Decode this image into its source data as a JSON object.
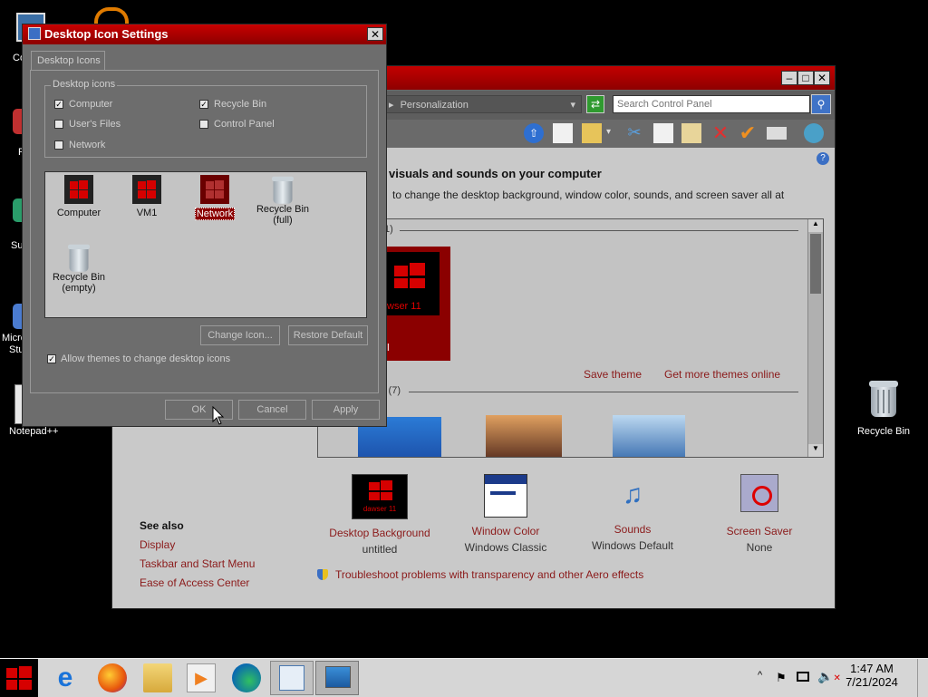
{
  "desktop": {
    "left_labels": [
      "Co",
      "F",
      "Su",
      "Micro",
      "Stu",
      "Notepad++"
    ],
    "recycle_bin": "Recycle Bin"
  },
  "control_panel": {
    "address": "Personalization",
    "search_placeholder": "Search Control Panel",
    "heading": "visuals and sounds on your computer",
    "subheading": "to change the desktop background, window color, sounds, and screen saver all at",
    "theme_group1": "1)",
    "theme_group2": "s (7)",
    "selected_theme_label": "wser 11",
    "selected_theme_sub": "ol",
    "save_theme": "Save theme",
    "get_more_themes": "Get more themes online",
    "see_also": {
      "title": "See also",
      "items": [
        "Display",
        "Taskbar and Start Menu",
        "Ease of Access Center"
      ]
    },
    "bottom": [
      {
        "name": "Desktop Background",
        "value": "untitled"
      },
      {
        "name": "Window Color",
        "value": "Windows Classic"
      },
      {
        "name": "Sounds",
        "value": "Windows Default"
      },
      {
        "name": "Screen Saver",
        "value": "None"
      }
    ],
    "db_logo_text": "dawser 11",
    "troubleshoot": "Troubleshoot problems with transparency and other Aero effects"
  },
  "dialog": {
    "title": "Desktop Icon Settings",
    "tab": "Desktop Icons",
    "group_label": "Desktop icons",
    "checks": [
      {
        "label": "Computer",
        "checked": true
      },
      {
        "label": "Recycle Bin",
        "checked": true
      },
      {
        "label": "User's Files",
        "checked": false
      },
      {
        "label": "Control Panel",
        "checked": false
      },
      {
        "label": "Network",
        "checked": false
      }
    ],
    "icons": [
      "Computer",
      "VM1",
      "Network",
      "Recycle Bin (full)",
      "Recycle Bin (empty)"
    ],
    "icon_label_lines": {
      "rb_full_1": "Recycle Bin",
      "rb_full_2": "(full)",
      "rb_empty_1": "Recycle Bin",
      "rb_empty_2": "(empty)"
    },
    "change_icon": "Change Icon...",
    "restore_default": "Restore Default",
    "allow_themes": "Allow themes to change desktop icons",
    "ok": "OK",
    "cancel": "Cancel",
    "apply": "Apply"
  },
  "clock": {
    "time": "1:47 AM",
    "date": "7/21/2024"
  },
  "colors": {
    "accent": "#c00000",
    "link": "#8b1a1a",
    "taskbar": "#d6d6d6"
  }
}
